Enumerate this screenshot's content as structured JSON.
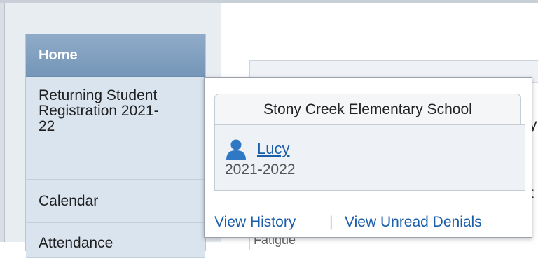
{
  "sidebar": {
    "items": [
      {
        "label": "Home"
      },
      {
        "label": "Returning Student Registration 2021-22"
      },
      {
        "label": "Calendar"
      },
      {
        "label": "Attendance"
      }
    ]
  },
  "popup": {
    "school_tab": "Stony Creek Elementary School",
    "student": {
      "icon": "person-icon",
      "name": "Lucy",
      "year": "2021-2022"
    },
    "footer": {
      "history_link": "View History",
      "separator": "|",
      "denials_link": "View Unread Denials"
    }
  },
  "background": {
    "partial_glyph_1": "y",
    "partial_glyph_2": "t",
    "partial_text": "Fatigue"
  },
  "colors": {
    "accent_link": "#1a5da8",
    "nav_active": "#8fabc8",
    "nav_bg": "#d9e4ef",
    "icon_blue": "#2f78c4"
  }
}
